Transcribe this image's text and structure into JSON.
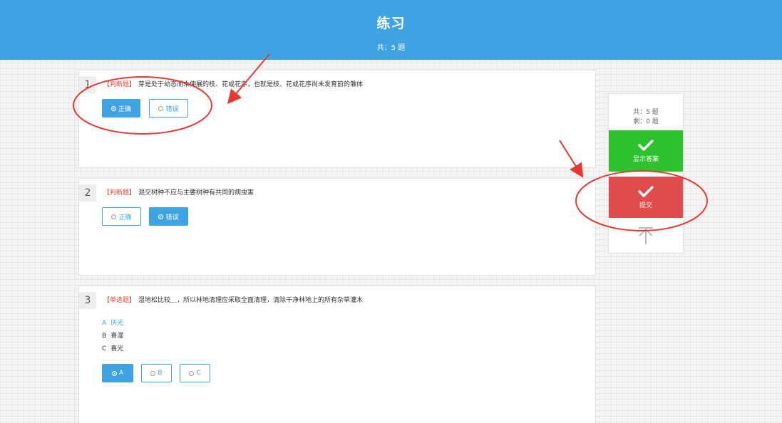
{
  "header": {
    "title": "练习",
    "count": "共：5 题"
  },
  "questions": [
    {
      "num": "1",
      "type": "【判断题】",
      "text": "芽是处于幼态而未伸展的枝、花或花序，也就是枝、花或花序尚未发育前的雏体",
      "buttons": [
        "正确",
        "错误"
      ],
      "selected": "正确"
    },
    {
      "num": "2",
      "type": "【判断题】",
      "text": "混交树种不应与主要树种有共同的病虫害",
      "buttons": [
        "正确",
        "错误"
      ],
      "selected": "错误"
    },
    {
      "num": "3",
      "type": "【单选题】",
      "text": "湿地松比较＿，所以林地清理应采取全面清理，清除干净林地上的所有杂草灌木",
      "options": [
        {
          "letter": "A",
          "text": "厌光"
        },
        {
          "letter": "B",
          "text": "喜湿"
        },
        {
          "letter": "C",
          "text": "喜光"
        }
      ],
      "buttons": [
        "A",
        "B",
        "C"
      ],
      "selected": "A"
    }
  ],
  "sidebar": {
    "total": "共：5 题",
    "remaining": "剩：0 题",
    "show_answer_label": "显示答案",
    "submit_label": "提交"
  },
  "colors": {
    "primary": "#3fa3e3",
    "show_answer": "#2ec12e",
    "submit": "#e04b4b",
    "annotation": "#e53935",
    "question_type": "#e0443c"
  }
}
